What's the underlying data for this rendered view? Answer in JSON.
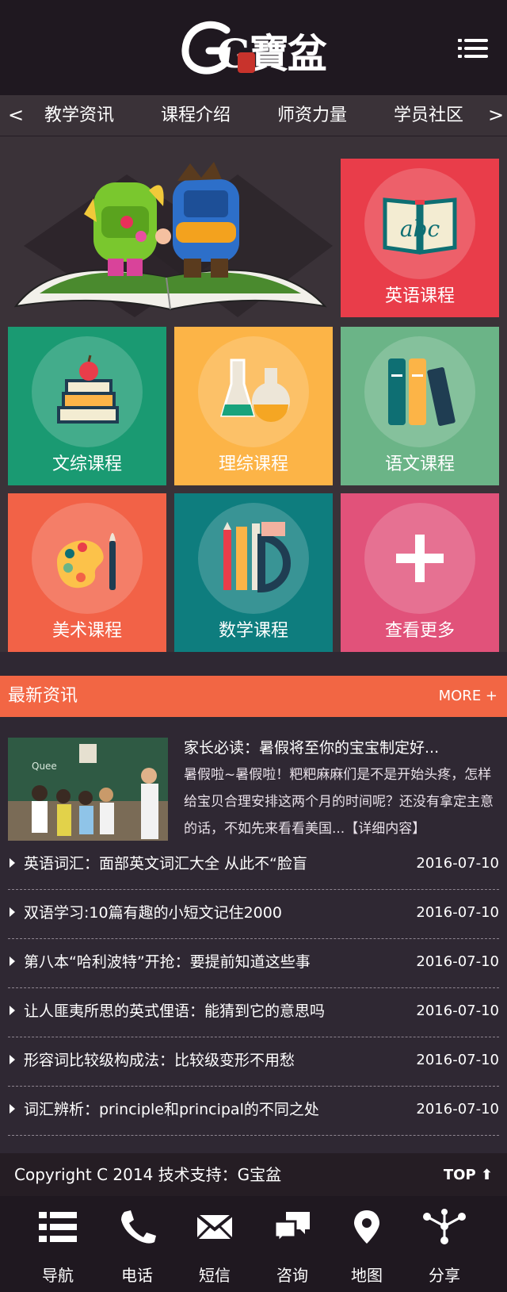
{
  "header": {
    "logo_text": "G寶盆",
    "menu_icon": "hamburger-menu-icon"
  },
  "catnav": {
    "prev": "<",
    "next": ">",
    "items": [
      "教学资讯",
      "课程介绍",
      "师资力量",
      "学员社区"
    ]
  },
  "courses": [
    {
      "label": "英语课程",
      "color": "#e93d4a",
      "icon": "book-abc-icon"
    },
    {
      "label": "文综课程",
      "color": "#1a9a72",
      "icon": "books-apple-icon"
    },
    {
      "label": "理综课程",
      "color": "#fcb447",
      "icon": "flask-icon"
    },
    {
      "label": "语文课程",
      "color": "#6bb487",
      "icon": "binders-icon"
    },
    {
      "label": "美术课程",
      "color": "#f26247",
      "icon": "palette-icon"
    },
    {
      "label": "数学课程",
      "color": "#0e7d7e",
      "icon": "ruler-pencil-icon"
    },
    {
      "label": "查看更多",
      "color": "#e1527a",
      "icon": "plus-icon"
    }
  ],
  "news": {
    "title": "最新资讯",
    "more": "MORE +",
    "feature": {
      "title": "家长必读：暑假将至你的宝宝制定好...",
      "desc": "暑假啦~暑假啦！粑粑麻麻们是不是开始头疼，怎样给宝贝合理安排这两个月的时间呢？还没有拿定主意的话，不如先来看看美国...【详细内容】"
    },
    "items": [
      {
        "text": "英语词汇：面部英文词汇大全 从此不“脸盲",
        "date": "2016-07-10"
      },
      {
        "text": "双语学习:10篇有趣的小短文记住2000",
        "date": "2016-07-10"
      },
      {
        "text": "第八本“哈利波特”开抢：要提前知道这些事",
        "date": "2016-07-10"
      },
      {
        "text": "让人匪夷所思的英式俚语：能猜到它的意思吗",
        "date": "2016-07-10"
      },
      {
        "text": "形容词比较级构成法：比较级变形不用愁",
        "date": "2016-07-10"
      },
      {
        "text": "词汇辨析：principle和principal的不同之处",
        "date": "2016-07-10"
      }
    ]
  },
  "footer": {
    "copyright": "Copyright C 2014 技术支持：G宝盆",
    "top": "TOP ⬆"
  },
  "bottom_nav": [
    {
      "label": "导航",
      "icon": "list-icon"
    },
    {
      "label": "电话",
      "icon": "phone-icon"
    },
    {
      "label": "短信",
      "icon": "envelope-icon"
    },
    {
      "label": "咨询",
      "icon": "chat-bubbles-icon"
    },
    {
      "label": "地图",
      "icon": "map-pin-icon"
    },
    {
      "label": "分享",
      "icon": "share-icon"
    }
  ]
}
